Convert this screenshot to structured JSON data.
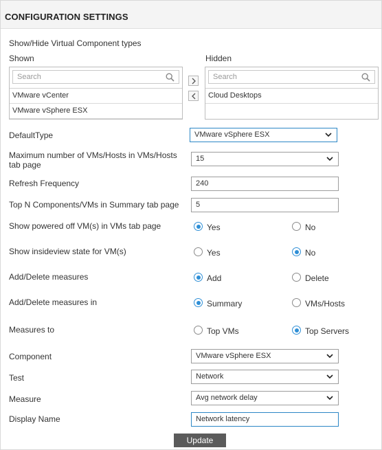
{
  "header": {
    "title": "CONFIGURATION SETTINGS"
  },
  "component_types": {
    "section_label": "Show/Hide Virtual Component types",
    "shown": {
      "label": "Shown",
      "search_placeholder": "Search",
      "items": [
        "VMware vCenter",
        "VMware vSphere ESX"
      ]
    },
    "hidden": {
      "label": "Hidden",
      "search_placeholder": "Search",
      "items": [
        "Cloud Desktops"
      ]
    },
    "move_right_glyph": ">",
    "move_left_glyph": "<"
  },
  "fields": {
    "default_type": {
      "label": "DefaultType",
      "value": "VMware vSphere ESX"
    },
    "max_vms": {
      "label_line1": "Maximum number of VMs/Hosts in VMs/Hosts",
      "label_line2": "tab page",
      "value": "15"
    },
    "refresh": {
      "label": "Refresh Frequency",
      "value": "240"
    },
    "top_n": {
      "label": "Top N Components/VMs in Summary tab page",
      "value": "5"
    }
  },
  "radios": {
    "powered_off": {
      "label": "Show powered off VM(s) in VMs tab page",
      "opt1": "Yes",
      "opt2": "No",
      "selected": "Yes"
    },
    "insideview": {
      "label": "Show insideview state for VM(s)",
      "opt1": "Yes",
      "opt2": "No",
      "selected": "No"
    },
    "add_delete": {
      "label": "Add/Delete measures",
      "opt1": "Add",
      "opt2": "Delete",
      "selected": "Add"
    },
    "add_delete_in": {
      "label": "Add/Delete measures in",
      "opt1": "Summary",
      "opt2": "VMs/Hosts",
      "selected": "Summary"
    },
    "measures_to": {
      "label": "Measures to",
      "opt1": "Top VMs",
      "opt2": "Top Servers",
      "selected": "Top Servers"
    }
  },
  "measure_config": {
    "component": {
      "label": "Component",
      "value": "VMware vSphere ESX"
    },
    "test": {
      "label": "Test",
      "value": "Network"
    },
    "measure": {
      "label": "Measure",
      "value": "Avg network delay"
    },
    "display_name": {
      "label": "Display Name",
      "value": "Network latency"
    }
  },
  "update_button": {
    "label": "Update"
  },
  "colors": {
    "accent": "#2f8fd6",
    "button_bg": "#5b5b5b",
    "header_bg": "#f4f4f4"
  }
}
